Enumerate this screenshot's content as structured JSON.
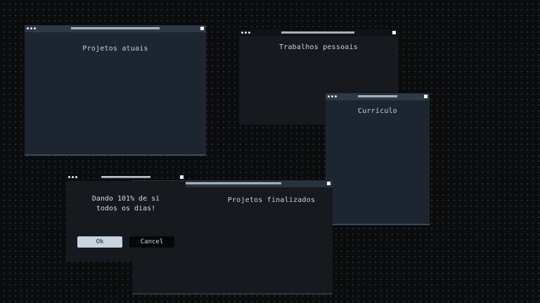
{
  "windows": {
    "current_projects": {
      "title": "Projetos atuais"
    },
    "personal_work": {
      "title": "Trabalhos pessoais"
    },
    "resume": {
      "title": "Currículo"
    },
    "finished_projects": {
      "title": "Projetos finalizados"
    }
  },
  "dialog": {
    "message": "Dando 101% de si\ntodos os dias!",
    "ok_label": "Ok",
    "cancel_label": "Cancel"
  },
  "colors": {
    "background": "#0b0c0d",
    "window_body": "#1d2630",
    "window_titlebar": "#2e3946",
    "dark_window_body": "#16191d",
    "ok_button": "#c9d4e0",
    "cancel_button": "#050607"
  }
}
